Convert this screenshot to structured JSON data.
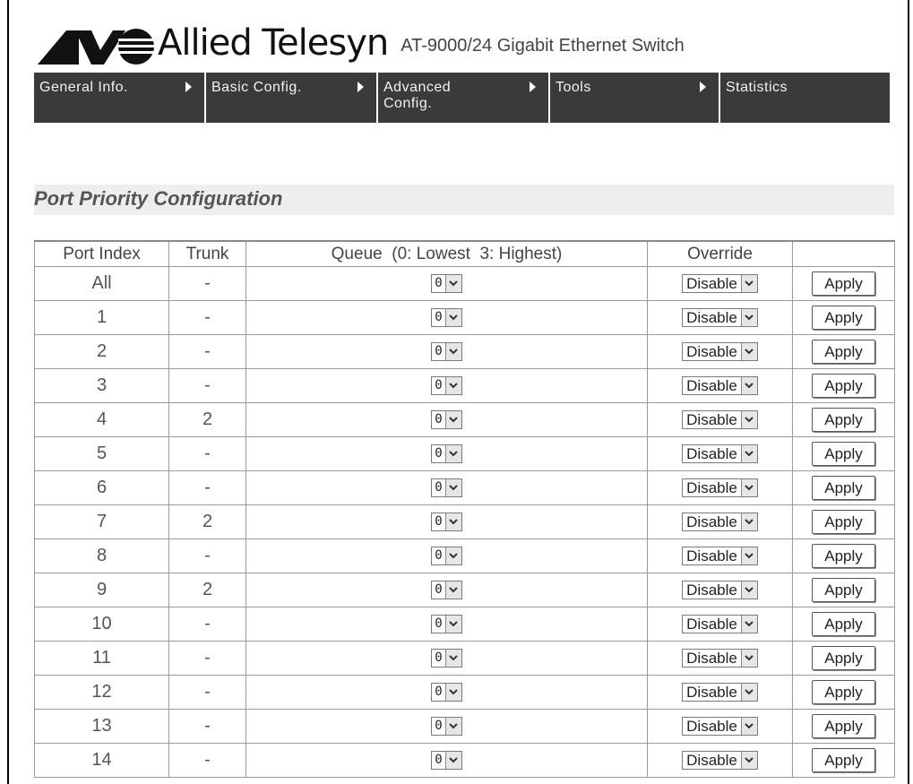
{
  "header": {
    "brand": "Allied Telesyn",
    "model": "AT-9000/24 Gigabit Ethernet Switch"
  },
  "nav": [
    {
      "label": "General Info.",
      "has_arrow": true
    },
    {
      "label": "Basic Config.",
      "has_arrow": true
    },
    {
      "label": "Advanced Config.",
      "has_arrow": true
    },
    {
      "label": "Tools",
      "has_arrow": true
    },
    {
      "label": "Statistics",
      "has_arrow": false
    }
  ],
  "page_title": "Port Priority Configuration",
  "table": {
    "columns": [
      "Port Index",
      "Trunk",
      "Queue  (0: Lowest  3: Highest)",
      "Override",
      ""
    ],
    "rows": [
      {
        "port": "All",
        "trunk": "-",
        "queue": "0",
        "override": "Disable",
        "action": "Apply"
      },
      {
        "port": "1",
        "trunk": "-",
        "queue": "0",
        "override": "Disable",
        "action": "Apply"
      },
      {
        "port": "2",
        "trunk": "-",
        "queue": "0",
        "override": "Disable",
        "action": "Apply"
      },
      {
        "port": "3",
        "trunk": "-",
        "queue": "0",
        "override": "Disable",
        "action": "Apply"
      },
      {
        "port": "4",
        "trunk": "2",
        "queue": "0",
        "override": "Disable",
        "action": "Apply"
      },
      {
        "port": "5",
        "trunk": "-",
        "queue": "0",
        "override": "Disable",
        "action": "Apply"
      },
      {
        "port": "6",
        "trunk": "-",
        "queue": "0",
        "override": "Disable",
        "action": "Apply"
      },
      {
        "port": "7",
        "trunk": "2",
        "queue": "0",
        "override": "Disable",
        "action": "Apply"
      },
      {
        "port": "8",
        "trunk": "-",
        "queue": "0",
        "override": "Disable",
        "action": "Apply"
      },
      {
        "port": "9",
        "trunk": "2",
        "queue": "0",
        "override": "Disable",
        "action": "Apply"
      },
      {
        "port": "10",
        "trunk": "-",
        "queue": "0",
        "override": "Disable",
        "action": "Apply"
      },
      {
        "port": "11",
        "trunk": "-",
        "queue": "0",
        "override": "Disable",
        "action": "Apply"
      },
      {
        "port": "12",
        "trunk": "-",
        "queue": "0",
        "override": "Disable",
        "action": "Apply"
      },
      {
        "port": "13",
        "trunk": "-",
        "queue": "0",
        "override": "Disable",
        "action": "Apply"
      },
      {
        "port": "14",
        "trunk": "-",
        "queue": "0",
        "override": "Disable",
        "action": "Apply"
      }
    ]
  },
  "icons": {
    "logo": "allied-telesyn-logo-icon",
    "nav_arrow": "arrow-right-icon",
    "dropdown": "chevron-down-icon"
  },
  "colors": {
    "nav_background": "#3a3a3a",
    "title_bar": "#eeeeee",
    "border": "#9a9a9a"
  }
}
